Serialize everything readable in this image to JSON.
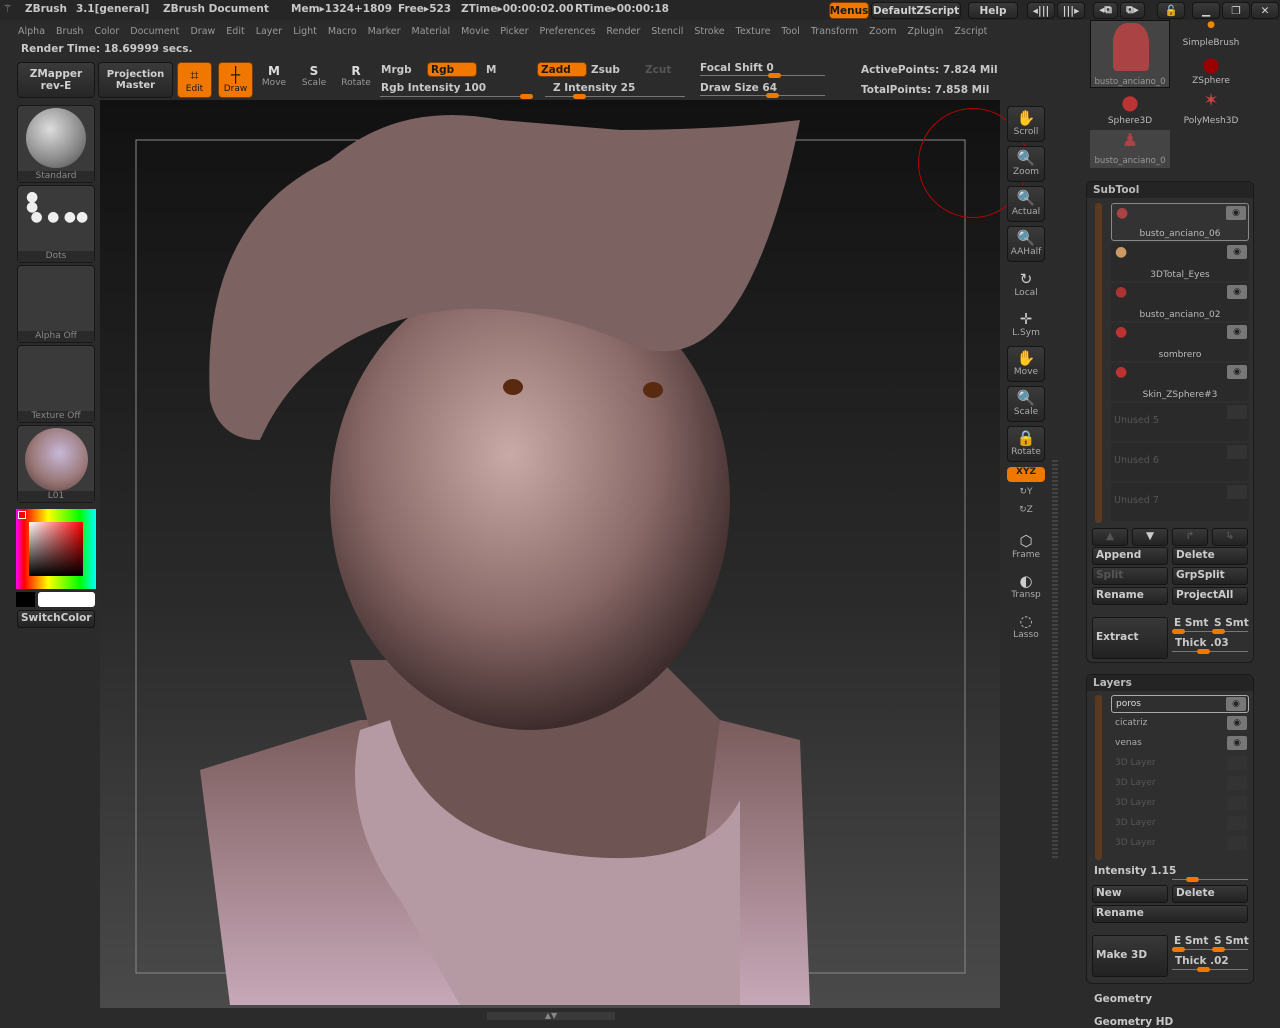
{
  "titlebar": {
    "app": "ZBrush",
    "version": "3.1[general]",
    "document": "ZBrush Document",
    "mem": "Mem▸1324+1809",
    "free": "Free▸523",
    "ztime": "ZTime▸00:00:02.00",
    "rtime": "RTime▸00:00:18",
    "menus_btn": "Menus",
    "script_btn": "DefaultZScript",
    "help_btn": "Help"
  },
  "menu": [
    "Alpha",
    "Brush",
    "Color",
    "Document",
    "Draw",
    "Edit",
    "Layer",
    "Light",
    "Macro",
    "Marker",
    "Material",
    "Movie",
    "Picker",
    "Preferences",
    "Render",
    "Stencil",
    "Stroke",
    "Texture",
    "Tool",
    "Transform",
    "Zoom",
    "Zplugin",
    "Zscript"
  ],
  "render_time": "Render Time: 18.69999 secs.",
  "toolbar": {
    "zmapper": "ZMapper",
    "zmapper_sub": "rev-E",
    "projection": "Projection",
    "projection_sub": "Master",
    "edit": "Edit",
    "draw": "Draw",
    "move": "Move",
    "scale": "Scale",
    "rotate": "Rotate",
    "mrgb": "Mrgb",
    "rgb": "Rgb",
    "m": "M",
    "rgb_intensity": "Rgb Intensity 100",
    "zadd": "Zadd",
    "zsub": "Zsub",
    "zcut": "Zcut",
    "z_intensity": "Z Intensity 25",
    "focal_shift": "Focal Shift 0",
    "draw_size": "Draw Size 64",
    "active_points": "ActivePoints: 7.824 Mil",
    "total_points": "TotalPoints: 7.858 Mil",
    "rgb_intensity_value": 100,
    "z_intensity_value": 25,
    "focal_shift_value": 0,
    "draw_size_value": 64
  },
  "left_shelf": {
    "brush": "Standard",
    "stroke": "Dots",
    "alpha": "Alpha Off",
    "texture": "Texture Off",
    "material": "L01",
    "switch_color": "SwitchColor",
    "main_color": "#ff0000",
    "secondary_color": "#ffffff"
  },
  "right_shelf": [
    "Scroll",
    "Zoom",
    "Actual",
    "AAHalf",
    "Local",
    "L.Sym",
    "Move",
    "Scale",
    "Rotate",
    "XYZ",
    "Frame",
    "Transp",
    "Lasso"
  ],
  "tool_thumbs": [
    "busto_anciano_0",
    "SimpleBrush",
    "ZSphere",
    "Sphere3D",
    "PolyMesh3D",
    "busto_anciano_0"
  ],
  "subtool": {
    "title": "SubTool",
    "items": [
      {
        "name": "busto_anciano_06",
        "visible": true
      },
      {
        "name": "3DTotal_Eyes",
        "visible": true
      },
      {
        "name": "busto_anciano_02",
        "visible": true
      },
      {
        "name": "sombrero",
        "visible": true
      },
      {
        "name": "Skin_ZSphere#3",
        "visible": true
      }
    ],
    "unused": [
      "Unused 5",
      "Unused 6",
      "Unused 7"
    ],
    "append": "Append",
    "delete": "Delete",
    "split": "Split",
    "grpsplit": "GrpSplit",
    "rename": "Rename",
    "projectall": "ProjectAll",
    "extract": "Extract",
    "e_smt": "E Smt",
    "s_smt": "S Smt",
    "thick": "Thick .03"
  },
  "layers": {
    "title": "Layers",
    "items": [
      "poros",
      "cicatriz",
      "venas",
      "3D Layer",
      "3D Layer",
      "3D Layer",
      "3D Layer",
      "3D Layer"
    ],
    "intensity": "Intensity 1.15",
    "intensity_value": 1.15,
    "new": "New",
    "delete": "Delete",
    "rename": "Rename",
    "make3d": "Make 3D",
    "e_smt": "E Smt",
    "s_smt": "S Smt",
    "thick": "Thick .02"
  },
  "footer": {
    "geometry": "Geometry",
    "geometry_hd": "Geometry HD"
  },
  "colors": {
    "accent": "#f07800",
    "clay": "#a88580"
  }
}
